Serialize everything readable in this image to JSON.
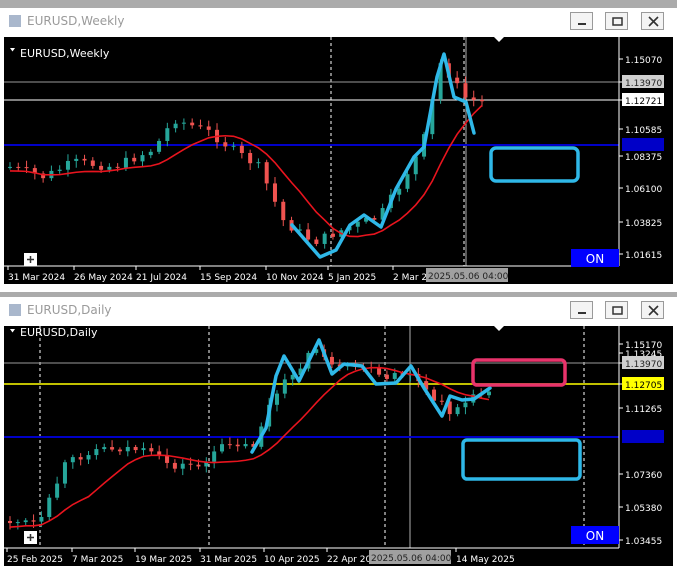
{
  "weekly": {
    "window_title": "EURUSD,Weekly",
    "chart_label": "EURUSD,Weekly",
    "price_labels": [
      "1.15070",
      "1.13970",
      "1.12721",
      "1.10585",
      "1.08375",
      "1.06100",
      "1.03825",
      "1.01615"
    ],
    "date_labels": [
      "31 Mar 2024",
      "26 May 2024",
      "21 Jul 2024",
      "15 Sep 2024",
      "10 Nov 2024",
      "5 Jan 2025",
      "2 Mar 2"
    ],
    "crosshair_time": "2025.05.06 04:00",
    "on_label": "ON",
    "colors": {
      "bull": "#26a69a",
      "bear": "#ef5350"
    }
  },
  "daily": {
    "window_title": "EURUSD,Daily",
    "chart_label": "EURUSD,Daily",
    "price_labels": [
      "1.15170",
      "1.13245",
      "1.13970",
      "1.12705",
      "1.11265",
      "1.07360",
      "1.05380",
      "1.03455"
    ],
    "date_labels": [
      "25 Feb 2025",
      "7 Mar 2025",
      "19 Mar 2025",
      "31 Mar 2025",
      "10 Apr 2025",
      "22 Apr 20",
      "14 May 2025"
    ],
    "crosshair_time": "2025.05.06 04:00",
    "on_label": "ON"
  },
  "colors": {
    "cyan": "#2fb8e8",
    "pink": "#e8336b",
    "ma": "#e8141e",
    "blue_line": "#0000c8",
    "yellow_line": "#ffff00",
    "on_bg": "#0000ff"
  }
}
